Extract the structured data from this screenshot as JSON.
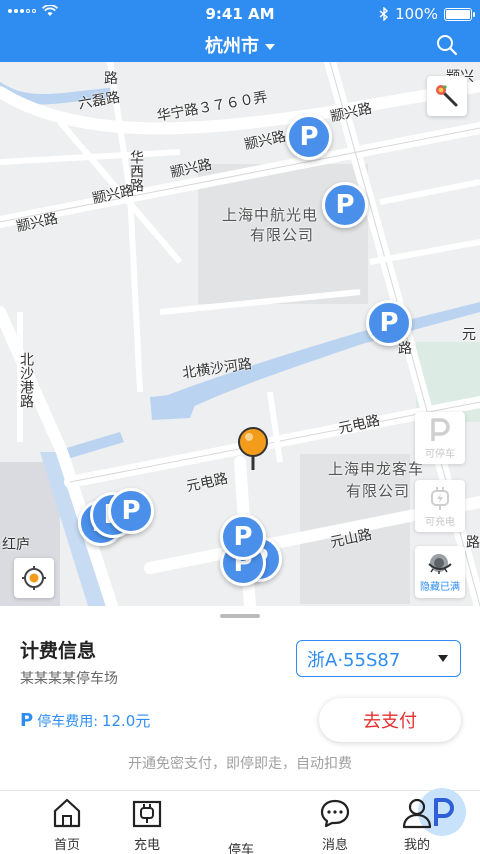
{
  "status_bar": {
    "time": "9:41 AM",
    "battery": "100%"
  },
  "header": {
    "city": "杭州市"
  },
  "map": {
    "road_labels": [
      "六磊路",
      "华宁路３７６０弄",
      "华西路",
      "颛兴路",
      "颛兴路",
      "颛兴路",
      "颛兴路",
      "颛兴路",
      "北沙港路",
      "北横沙河路",
      "元电路",
      "元电路",
      "元山路",
      "路",
      "元",
      "颛兴",
      "红庐",
      "路",
      "路"
    ],
    "poi_labels": [
      "上海中航光电",
      "有限公司",
      "上海申龙客车",
      "有限公司"
    ],
    "parking_marker_text": "P",
    "side_buttons": [
      {
        "label": "可停车",
        "icon": "parking-icon"
      },
      {
        "label": "可充电",
        "icon": "charging-plug-icon"
      },
      {
        "label": "隐藏已满",
        "icon": "eye-closed-icon"
      }
    ]
  },
  "panel": {
    "title": "计费信息",
    "lot_name": "某某某某停车场",
    "plate": "浙A·55S87",
    "fee_label": "停车费用:",
    "fee_value": "12.0元",
    "pay_button": "去支付",
    "promo": "开通免密支付，即停即走，自动扣费"
  },
  "tabs": [
    {
      "label": "首页",
      "icon": "home-icon"
    },
    {
      "label": "充电",
      "icon": "charging-icon"
    },
    {
      "label": "停车",
      "icon": "parking-icon"
    },
    {
      "label": "消息",
      "icon": "message-icon"
    },
    {
      "label": "我的",
      "icon": "profile-icon"
    }
  ],
  "colors": {
    "brand": "#2f8df2",
    "marker": "#4a8fea",
    "pay_text": "#e63030",
    "pin": "#f39b1b"
  }
}
